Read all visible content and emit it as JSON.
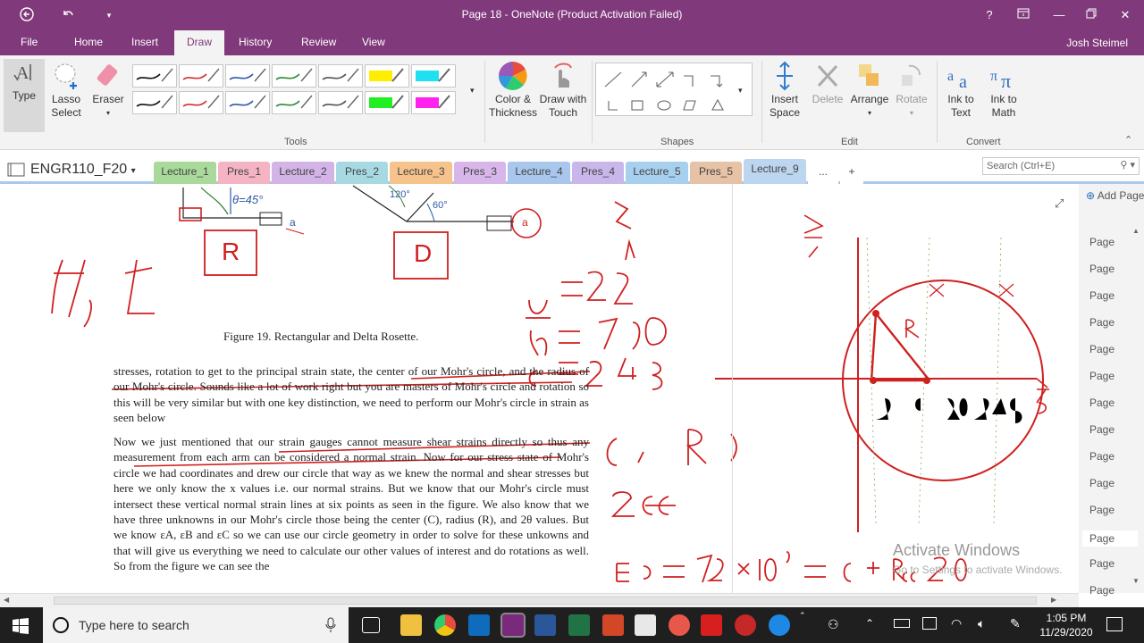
{
  "window": {
    "title": "Page 18 - OneNote (Product Activation Failed)",
    "user": "Josh Steimel"
  },
  "titlebar_icons": [
    "back-arrow-icon",
    "undo-icon",
    "customize-icon"
  ],
  "window_controls": [
    "?",
    "restore-ribbon",
    "minimize",
    "maximize",
    "close"
  ],
  "menu": {
    "items": [
      "File",
      "Home",
      "Insert",
      "Draw",
      "History",
      "Review",
      "View"
    ],
    "active": "Draw"
  },
  "ribbon": {
    "type_label": "Type",
    "lasso_label": "Lasso Select",
    "eraser_label": "Eraser",
    "color_label": "Color & Thickness",
    "draw_touch_label": "Draw with Touch",
    "insert_space_label": "Insert Space",
    "delete_label": "Delete",
    "arrange_label": "Arrange",
    "rotate_label": "Rotate",
    "ink_text_label": "Ink to Text",
    "ink_math_label": "Ink to Math",
    "groups": {
      "tools": "Tools",
      "shapes": "Shapes",
      "edit": "Edit",
      "convert": "Convert"
    },
    "pens": [
      {
        "color": "#111111"
      },
      {
        "color": "#d32f2f"
      },
      {
        "color": "#2e5aa8"
      },
      {
        "color": "#2e8b3e"
      },
      {
        "color": "#555555"
      },
      {
        "color": "#ffee00",
        "hl": true
      },
      {
        "color": "#1ee0f0",
        "hl": true
      },
      {
        "color": "#111111"
      },
      {
        "color": "#d32f2f"
      },
      {
        "color": "#2e5aa8"
      },
      {
        "color": "#2e8b3e"
      },
      {
        "color": "#555555"
      },
      {
        "color": "#22ee22",
        "hl": true
      },
      {
        "color": "#ff22ee",
        "hl": true
      }
    ]
  },
  "notebook": {
    "name": "ENGR110_F20",
    "search_placeholder": "Search (Ctrl+E)",
    "tabs": [
      {
        "label": "Lecture_1",
        "color": "#a9d99b"
      },
      {
        "label": "Pres_1",
        "color": "#f4b4c4"
      },
      {
        "label": "Lecture_2",
        "color": "#d2b4e6"
      },
      {
        "label": "Pres_2",
        "color": "#a7d9e3"
      },
      {
        "label": "Lecture_3",
        "color": "#f6c38c"
      },
      {
        "label": "Pres_3",
        "color": "#d8b6ea"
      },
      {
        "label": "Lecture_4",
        "color": "#a9c6ec"
      },
      {
        "label": "Pres_4",
        "color": "#c9b6ea"
      },
      {
        "label": "Lecture_5",
        "color": "#a7d0ee"
      },
      {
        "label": "Pres_5",
        "color": "#e6c2a6"
      },
      {
        "label": "Lecture_9",
        "color": "#bcd6f0"
      },
      {
        "label": "...",
        "color": "#ffffff"
      },
      {
        "label": "+",
        "color": "#ffffff"
      }
    ],
    "active_tab": "Lecture_9"
  },
  "document": {
    "figure_caption": "Figure 19. Rectangular and Delta Rosette.",
    "para1": "stresses, rotation to get to the principal strain state, the center of our Mohr's circle, and the radius of our Mohr's circle. Sounds like a lot of work right but you are masters of Mohr's circle and rotation so this will be very similar but with one key distinction, we need to perform our Mohr's circle in strain as seen below",
    "para2": "Now we just mentioned that our strain gauges cannot measure shear strains directly so thus any measurement from each arm can be considered a normal strain. Now for our stress state of Mohr's circle we had coordinates and drew our circle that way as we knew the normal and shear stresses but here we only know the x values i.e. our normal strains. But we know that our Mohr's circle must intersect these vertical normal strain lines at six points as seen in the figure. We also know that we have three unknowns in our Mohr's circle those being the center (C), radius (R), and 2θ values. But we know εA, εB and εC so we can use our circle geometry in order to solve for these unkowns and that will give us everything we need to calculate our other values of interest and do rotations as well. So from the figure we can see the",
    "fig_labels": {
      "theta45": "θ=45°",
      "a1": "a",
      "a2": "a",
      "R": "R",
      "D": "D",
      "deg120": "120°",
      "deg60": "60°"
    }
  },
  "ink": {
    "sigma_tau": "σ, τ",
    "eps": "ε",
    "abc": [
      "a = 72",
      "b = 170",
      "c = 248"
    ],
    "CR": "C, R",
    "two_theta": "2θ",
    "half_gamma": "γ/2",
    "Rlabel": "R",
    "axis_ticks": "72  C 120  248",
    "eps_axis": "ε",
    "bottom_eq": "εa = 72×10⁻⁶ = C + R cos 2θ"
  },
  "page_panel": {
    "add_label": "Add Page",
    "pages": [
      "Page",
      "Page",
      "Page",
      "Page",
      "Page",
      "Page",
      "Page",
      "Page",
      "Page",
      "Page",
      "Page",
      "Page",
      "Page",
      "Page"
    ],
    "selected_index": 11
  },
  "activation": {
    "line1": "Activate Windows",
    "line2": "Go to Settings to activate Windows."
  },
  "taskbar": {
    "search_placeholder": "Type here to search",
    "time": "1:05 PM",
    "date": "11/29/2020"
  }
}
